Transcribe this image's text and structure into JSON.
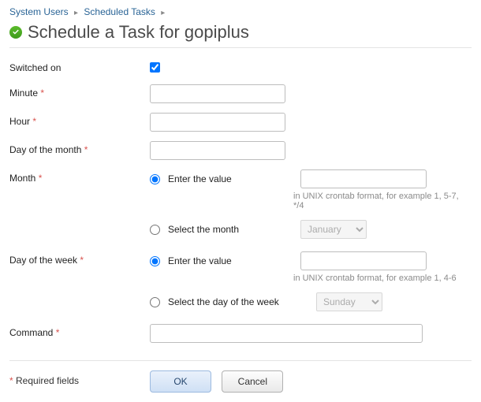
{
  "breadcrumb": {
    "item1": "System Users",
    "item2": "Scheduled Tasks"
  },
  "page_title": "Schedule a Task for gopiplus",
  "labels": {
    "switched_on": "Switched on",
    "minute": "Minute",
    "hour": "Hour",
    "day_of_month": "Day of the month",
    "month": "Month",
    "day_of_week": "Day of the week",
    "command": "Command",
    "enter_value": "Enter the value",
    "select_month": "Select the month",
    "select_dow": "Select the day of the week",
    "required_fields": "Required fields"
  },
  "hints": {
    "month": "in UNIX crontab format, for example 1, 5-7, */4",
    "dow": "in UNIX crontab format, for example 1, 4-6"
  },
  "selects": {
    "month_selected": "January",
    "dow_selected": "Sunday"
  },
  "buttons": {
    "ok": "OK",
    "cancel": "Cancel"
  },
  "values": {
    "switched_on": true,
    "minute": "",
    "hour": "",
    "day_of_month": "",
    "month_text": "",
    "dow_text": "",
    "command": ""
  }
}
